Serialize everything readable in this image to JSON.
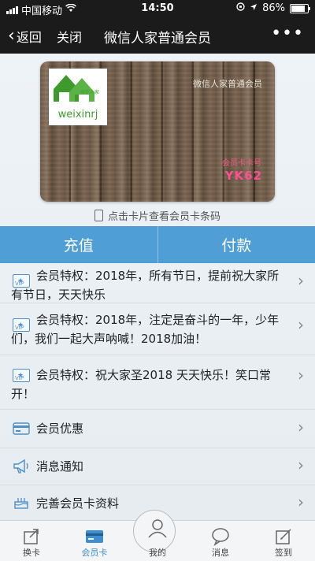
{
  "status_bar": {
    "carrier": "中国移动",
    "time": "14:50",
    "battery": "86%"
  },
  "nav": {
    "back_label": "返回",
    "close_label": "关闭",
    "title": "微信人家普通会员",
    "more": "•••"
  },
  "card": {
    "logo_text": "weixinrj",
    "logo_small": "微信人家",
    "name": "微信人家普通会员",
    "number_label": "会员卡卡号",
    "number": "YK62"
  },
  "hint": "点击卡片查看会员卡条码",
  "actions": {
    "recharge": "充值",
    "pay": "付款"
  },
  "rows": [
    {
      "text": "会员特权：2018年，所有节日，提前祝大家所有节日，天天快乐",
      "icon": "vip-icon"
    },
    {
      "text": "会员特权：2018年，注定是奋斗的一年，少年们，我们一起大声呐喊！2018加油！",
      "icon": "vip-icon"
    },
    {
      "text": "会员特权：祝大家圣2018 天天快乐！笑口常开！",
      "icon": "vip-icon"
    },
    {
      "text": "会员优惠",
      "icon": "card-icon"
    },
    {
      "text": "消息通知",
      "icon": "megaphone-icon"
    },
    {
      "text": "完善会员卡资料",
      "icon": "cake-icon"
    }
  ],
  "tabs": [
    {
      "label": "换卡",
      "icon": "switch-card-icon"
    },
    {
      "label": "会员卡",
      "icon": "member-card-icon"
    },
    {
      "label": "我的",
      "icon": "user-icon"
    },
    {
      "label": "消息",
      "icon": "message-icon"
    },
    {
      "label": "签到",
      "icon": "checkin-icon"
    }
  ],
  "colors": {
    "accent": "#4f9fd6",
    "card_number": "#ff4f93",
    "logo_green": "#3f9a2e"
  }
}
